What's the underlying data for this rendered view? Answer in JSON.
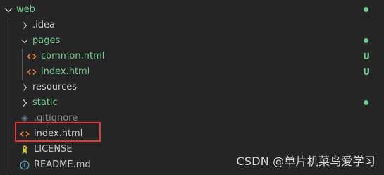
{
  "explorer": {
    "items": [
      {
        "label": "web",
        "kind": "folder-open",
        "depth": 0,
        "color": "green",
        "status": "dot"
      },
      {
        "label": ".idea",
        "kind": "folder-closed",
        "depth": 1,
        "color": "normal",
        "status": ""
      },
      {
        "label": "pages",
        "kind": "folder-open",
        "depth": 1,
        "color": "green",
        "status": "dot"
      },
      {
        "label": "common.html",
        "kind": "html-file",
        "depth": 2,
        "color": "green",
        "status": "U"
      },
      {
        "label": "index.html",
        "kind": "html-file",
        "depth": 2,
        "color": "green",
        "status": "U"
      },
      {
        "label": "resources",
        "kind": "folder-closed",
        "depth": 1,
        "color": "normal",
        "status": ""
      },
      {
        "label": "static",
        "kind": "folder-closed",
        "depth": 1,
        "color": "green",
        "status": "dot"
      },
      {
        "label": ".gitignore",
        "kind": "gitignore-file",
        "depth": 1,
        "color": "normal",
        "status": ""
      },
      {
        "label": "index.html",
        "kind": "html-file",
        "depth": 1,
        "color": "normal",
        "status": ""
      },
      {
        "label": "LICENSE",
        "kind": "license-file",
        "depth": 1,
        "color": "normal",
        "status": ""
      },
      {
        "label": "README.md",
        "kind": "info-file",
        "depth": 1,
        "color": "normal",
        "status": ""
      }
    ]
  },
  "watermark": "CSDN @单片机菜鸟爱学习",
  "colors": {
    "background": "#252526",
    "untracked_green": "#73c991",
    "html_icon": "#e37933",
    "highlight": "#e53935",
    "license_icon": "#cbcb41",
    "info_icon": "#519aba"
  }
}
